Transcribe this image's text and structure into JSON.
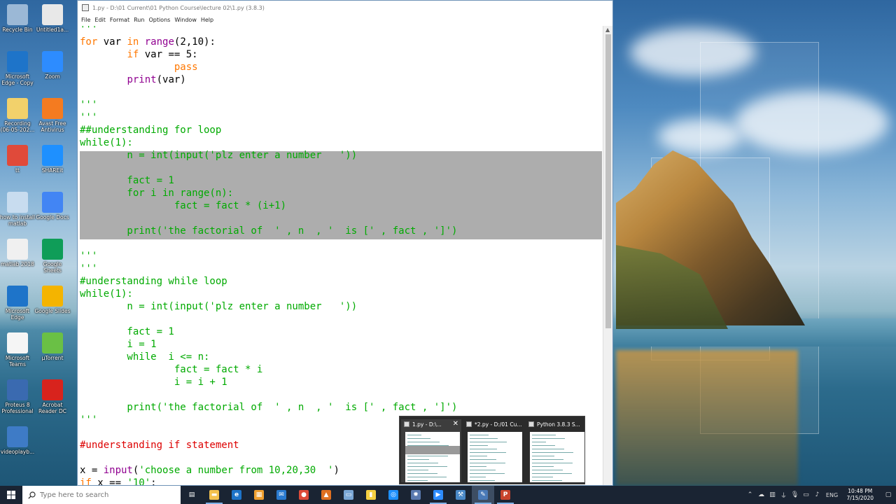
{
  "desktop": {
    "icons": [
      {
        "label": "Recycle Bin",
        "icon": "recycle-bin-icon",
        "color": "#9bb8d6"
      },
      {
        "label": "Untitled1a...",
        "icon": "document-icon",
        "color": "#e8e8e8"
      },
      {
        "label": "Microsoft Edge - Copy",
        "icon": "edge-icon",
        "color": "#1e74c9"
      },
      {
        "label": "Zoom",
        "icon": "zoom-icon",
        "color": "#2d8cff"
      },
      {
        "label": "Recording (06-05-202...",
        "icon": "recording-file-icon",
        "color": "#f2d16b"
      },
      {
        "label": "Avast Free Antivirus",
        "icon": "avast-icon",
        "color": "#f47b20"
      },
      {
        "label": "tt",
        "icon": "pdf-file-icon",
        "color": "#e04a3a"
      },
      {
        "label": "SHAREit",
        "icon": "shareit-icon",
        "color": "#1e90ff"
      },
      {
        "label": "how to install matlab",
        "icon": "shortcut-icon",
        "color": "#c8dcef"
      },
      {
        "label": "Google Docs",
        "icon": "google-docs-icon",
        "color": "#4285f4"
      },
      {
        "label": "matlab 2018",
        "icon": "text-file-icon",
        "color": "#f0f0f0"
      },
      {
        "label": "Google Sheets",
        "icon": "google-sheets-icon",
        "color": "#0f9d58"
      },
      {
        "label": "Microsoft Edge",
        "icon": "edge-icon",
        "color": "#1e74c9"
      },
      {
        "label": "Google Slides",
        "icon": "google-slides-icon",
        "color": "#f4b400"
      },
      {
        "label": "Microsoft Teams",
        "icon": "blank-file-icon",
        "color": "#f5f5f5"
      },
      {
        "label": "µTorrent",
        "icon": "utorrent-icon",
        "color": "#6ac045"
      },
      {
        "label": "Proteus 8 Professional",
        "icon": "proteus-icon",
        "color": "#3a6ab0"
      },
      {
        "label": "Acrobat Reader DC",
        "icon": "acrobat-icon",
        "color": "#d8231d"
      },
      {
        "label": "videoplayb...",
        "icon": "video-file-icon",
        "color": "#3e7bc6"
      }
    ]
  },
  "editor": {
    "title": "1.py - D:\\01 Current\\01 Python Course\\lecture 02\\1.py (3.8.3)",
    "menu": [
      "File",
      "Edit",
      "Format",
      "Run",
      "Options",
      "Window",
      "Help"
    ],
    "code": [
      [
        {
          "t": "'''",
          "c": "st"
        }
      ],
      [
        {
          "t": "for ",
          "c": "kw"
        },
        {
          "t": "var ",
          "c": "tx"
        },
        {
          "t": "in ",
          "c": "kw"
        },
        {
          "t": "range",
          "c": "bi"
        },
        {
          "t": "(2,10):",
          "c": "tx"
        }
      ],
      [
        {
          "t": "        ",
          "c": "tx"
        },
        {
          "t": "if ",
          "c": "kw"
        },
        {
          "t": "var == 5:",
          "c": "tx"
        }
      ],
      [
        {
          "t": "                ",
          "c": "tx"
        },
        {
          "t": "pass",
          "c": "kw"
        }
      ],
      [
        {
          "t": "        ",
          "c": "tx"
        },
        {
          "t": "print",
          "c": "bi"
        },
        {
          "t": "(var)",
          "c": "tx"
        }
      ],
      [],
      [
        {
          "t": "'''",
          "c": "st"
        }
      ],
      [
        {
          "t": "'''",
          "c": "st"
        }
      ],
      [
        {
          "t": "##understanding for loop",
          "c": "st"
        }
      ],
      [
        {
          "t": "while(1):",
          "c": "st"
        }
      ],
      [
        {
          "t": "        n = int(input('plz enter a number   '))",
          "c": "st"
        }
      ],
      [],
      [
        {
          "t": "        fact = 1",
          "c": "st"
        }
      ],
      [
        {
          "t": "        for i in range(n):",
          "c": "st"
        }
      ],
      [
        {
          "t": "                fact = fact * (i+1)",
          "c": "st"
        }
      ],
      [],
      [
        {
          "t": "        print('the factorial of  ' , n  , '  is [' , fact , ']')",
          "c": "st"
        }
      ],
      [],
      [
        {
          "t": "'''",
          "c": "st"
        }
      ],
      [
        {
          "t": "'''",
          "c": "st"
        }
      ],
      [
        {
          "t": "#understanding while loop",
          "c": "st"
        }
      ],
      [
        {
          "t": "while(1):",
          "c": "st"
        }
      ],
      [
        {
          "t": "        n = int(input('plz enter a number   '))",
          "c": "st"
        }
      ],
      [],
      [
        {
          "t": "        fact = 1",
          "c": "st"
        }
      ],
      [
        {
          "t": "        i = 1",
          "c": "st"
        }
      ],
      [
        {
          "t": "        while  i <= n:",
          "c": "st"
        }
      ],
      [
        {
          "t": "                fact = fact * i",
          "c": "st"
        }
      ],
      [
        {
          "t": "                i = i + 1",
          "c": "st"
        }
      ],
      [],
      [
        {
          "t": "        print('the factorial of  ' , n  , '  is [' , fact , ']')",
          "c": "st"
        }
      ],
      [
        {
          "t": "'''",
          "c": "st"
        }
      ],
      [],
      [
        {
          "t": "#understanding if statement",
          "c": "co"
        }
      ],
      [],
      [
        {
          "t": "x = ",
          "c": "tx"
        },
        {
          "t": "input",
          "c": "bi"
        },
        {
          "t": "(",
          "c": "tx"
        },
        {
          "t": "'choose a number from 10,20,30  '",
          "c": "st"
        },
        {
          "t": ")",
          "c": "tx"
        }
      ],
      [
        {
          "t": "if ",
          "c": "kw"
        },
        {
          "t": "x == ",
          "c": "tx"
        },
        {
          "t": "'10'",
          "c": "st"
        },
        {
          "t": ":",
          "c": "tx"
        }
      ]
    ]
  },
  "previews": [
    {
      "label": "1.py - D:\\...",
      "hovered": true,
      "closable": true
    },
    {
      "label": "*2.py - D:/01 Cu...",
      "hovered": false,
      "closable": false
    },
    {
      "label": "Python 3.8.3 S...",
      "hovered": false,
      "closable": false
    }
  ],
  "taskbar": {
    "search_placeholder": "Type here to search",
    "apps": [
      {
        "name": "task-view",
        "glyph": "▤",
        "color": "#1a2433",
        "open": false
      },
      {
        "name": "file-explorer",
        "glyph": "▬",
        "color": "#f2c14e",
        "open": true
      },
      {
        "name": "edge",
        "glyph": "e",
        "color": "#1e74c9",
        "open": false
      },
      {
        "name": "store",
        "glyph": "▦",
        "color": "#f0a030",
        "open": false
      },
      {
        "name": "mail",
        "glyph": "✉",
        "color": "#2a7ad0",
        "open": false
      },
      {
        "name": "chrome",
        "glyph": "●",
        "color": "#dd4b39",
        "open": false
      },
      {
        "name": "matlab",
        "glyph": "▲",
        "color": "#e07020",
        "open": false
      },
      {
        "name": "notepad",
        "glyph": "▭",
        "color": "#7aa7d6",
        "open": false
      },
      {
        "name": "sticky-notes",
        "glyph": "▮",
        "color": "#f5d042",
        "open": false
      },
      {
        "name": "shareit",
        "glyph": "◎",
        "color": "#1e90ff",
        "open": false
      },
      {
        "name": "proteus",
        "glyph": "✹",
        "color": "#5a7ab0",
        "open": false
      },
      {
        "name": "zoom",
        "glyph": "▶",
        "color": "#2d8cff",
        "open": true
      },
      {
        "name": "network-tool",
        "glyph": "⚒",
        "color": "#4a89c8",
        "open": false
      },
      {
        "name": "python-idle",
        "glyph": "✎",
        "color": "#4a7ab8",
        "open": true,
        "active": true
      },
      {
        "name": "powerpoint",
        "glyph": "P",
        "color": "#c8432b",
        "open": true
      }
    ],
    "tray": {
      "language": "ENG",
      "time": "10:48 PM",
      "date": "7/15/2020"
    }
  }
}
